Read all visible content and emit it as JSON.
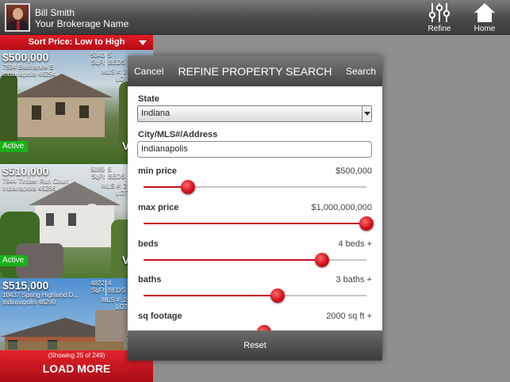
{
  "topbar": {
    "agent_name": "Bill Smith",
    "brokerage": "Your Brokerage Name",
    "refine_label": "Refine",
    "home_label": "Home"
  },
  "sort": {
    "label": "Sort Price: Low to High"
  },
  "listings": [
    {
      "price": "$500,000",
      "address1": "7594 Ballinshire S",
      "address2": "Indianapolis 46254",
      "sqft": "5040",
      "sqft_label": "SqFt",
      "beds": "5",
      "beds_label": "BEDS",
      "mls": "MLS #: 2",
      "lot": "LOT",
      "status": "Active",
      "view": "V"
    },
    {
      "price": "$510,000",
      "address1": "7844 Timber Run Court",
      "address2": "Indianapolis 46256",
      "sqft": "5089",
      "sqft_label": "SqFt",
      "beds": "5",
      "beds_label": "BEDS",
      "mls": "MLS #: 2",
      "lot": "LOT",
      "status": "Active",
      "view": "V"
    },
    {
      "price": "$515,000",
      "address1": "10437 Spring Highland D...",
      "address2": "Indianapolis 46290",
      "sqft": "4822",
      "sqft_label": "SqFt",
      "beds": "4",
      "beds_label": "BEDS",
      "mls": "MLS #: 2",
      "lot": "LOT"
    }
  ],
  "load_more": {
    "showing": "(Showing 25 of 249)",
    "label": "LOAD MORE"
  },
  "modal": {
    "cancel": "Cancel",
    "title": "REFINE PROPERTY SEARCH",
    "search": "Search",
    "state_label": "State",
    "state_value": "Indiana",
    "city_label": "City/MLS#/Address",
    "city_value": "Indianapolis",
    "min_price_label": "min price",
    "min_price_value": "$500,000",
    "min_price_level": 0.2,
    "max_price_label": "max price",
    "max_price_value": "$1,000,000,000",
    "max_price_level": 1.0,
    "beds_label": "beds",
    "beds_value": "4 beds +",
    "beds_level": 0.8,
    "baths_label": "baths",
    "baths_value": "3 baths +",
    "baths_level": 0.6,
    "sqft_label": "sq footage",
    "sqft_value": "2000 sq ft +",
    "sqft_level": 0.54,
    "reset": "Reset"
  },
  "colors": {
    "accent": "#c4101a",
    "active_badge": "#19b219"
  }
}
